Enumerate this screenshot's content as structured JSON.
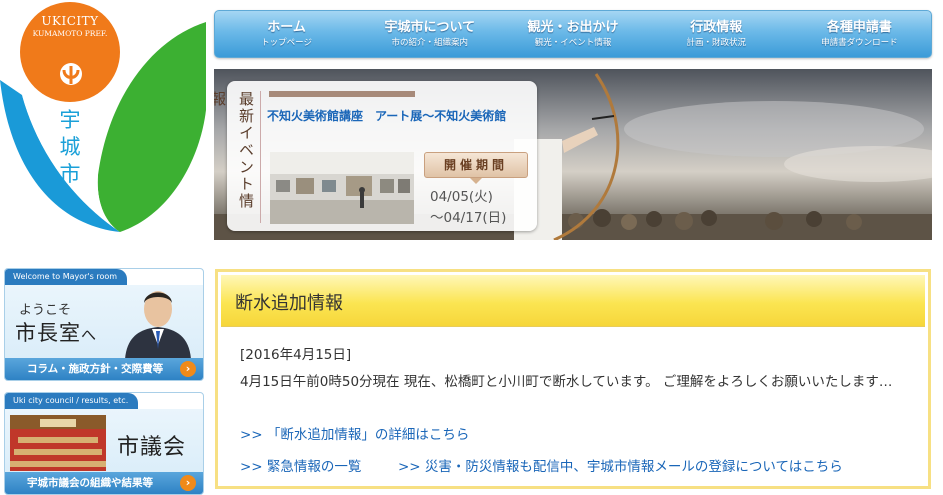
{
  "logo": {
    "name_en": "UKICITY",
    "name_en_sub": "KUMAMOTO PREF.",
    "name_ja": "宇城市",
    "colors": {
      "orange": "#f07a1a",
      "blue": "#1a9ad8",
      "green": "#3cb032"
    }
  },
  "nav": {
    "items": [
      {
        "label": "ホーム",
        "sub": "トップページ"
      },
      {
        "label": "宇城市について",
        "sub": "市の紹介・組織案内"
      },
      {
        "label": "観光・お出かけ",
        "sub": "観光・イベント情報"
      },
      {
        "label": "行政情報",
        "sub": "計画・財政状況"
      },
      {
        "label": "各種申請書",
        "sub": "申請書ダウンロード"
      }
    ]
  },
  "hero": {
    "event_heading": "最新イベント情報",
    "event_title": "不知火美術館講座　アート展〜不知火美術館",
    "period_label": "開催期間",
    "date_start": "04/05(火)",
    "date_end": "〜04/17(日)"
  },
  "sidebar": {
    "mayor": {
      "tab": "Welcome to Mayor's room",
      "greeting_small": "ようこそ",
      "greeting_big": "市長室",
      "greeting_suffix": "へ",
      "footer": "コラム・施政方針・交際費等",
      "arrow": "›"
    },
    "council": {
      "tab": "Uki city council / results, etc.",
      "title": "市議会",
      "footer": "宇城市議会の組織や結果等",
      "arrow": "›"
    }
  },
  "notice": {
    "title": "断水追加情報",
    "date": "[2016年4月15日]",
    "body": "4月15日午前0時50分現在 現在、松橋町と小川町で断水しています。 ご理解をよろしくお願いいたします…",
    "links": [
      ">> 「断水追加情報」の詳細はこちら",
      ">> 緊急情報の一覧",
      ">> 災害・防災情報も配信中、宇城市情報メールの登録についてはこちら"
    ]
  }
}
